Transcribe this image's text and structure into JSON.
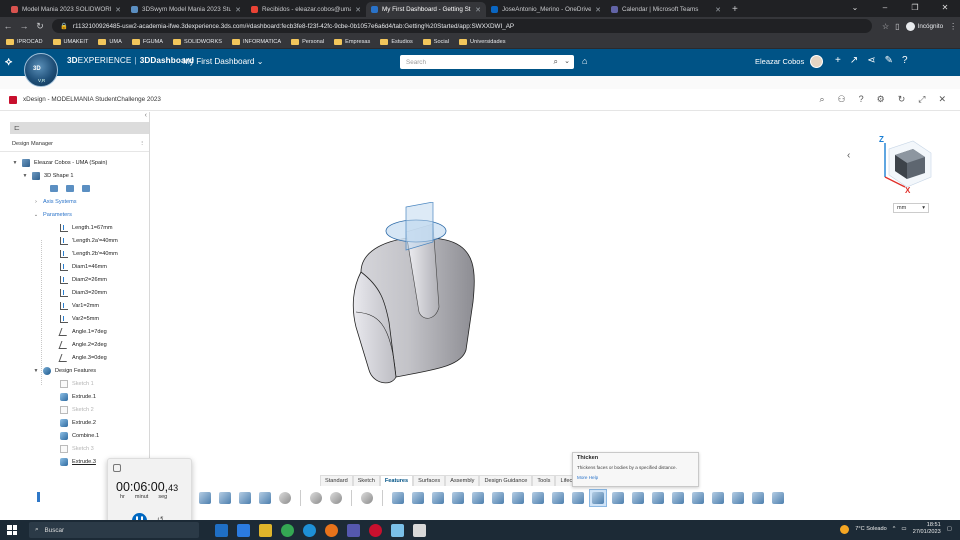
{
  "browser": {
    "tabs": [
      {
        "title": "Model Mania 2023 SOLIDWORKS",
        "color": "#d9534f",
        "active": false
      },
      {
        "title": "3DSwym Model Mania 2023 Stu",
        "color": "#5b8fc2",
        "active": false
      },
      {
        "title": "Recibidos - eleazar.cobos@uma",
        "color": "#ea4335",
        "active": false
      },
      {
        "title": "My First Dashboard - Getting St",
        "color": "#2a73c9",
        "active": true
      },
      {
        "title": "JoseAntonio_Merino - OneDrive",
        "color": "#0a66c2",
        "active": false
      },
      {
        "title": "Calendar | Microsoft Teams",
        "color": "#6264a7",
        "active": false
      }
    ],
    "url": "r1132100926485-usw2-academia-ifwe.3dexperience.3ds.com/#dashboard:fecb3fe8-f23f-42fc-9cbe-0b1057e6a6d4/tab:Getting%20Started/app:SWXXDWI_AP",
    "incognito_label": "Incógnito",
    "bookmarks": [
      "IPROCAD",
      "UMAKEIT",
      "UMA",
      "FGUMA",
      "SOLIDWORKS",
      "INFORMATICA",
      "Personal",
      "Empresas",
      "Estudios",
      "Social",
      "Universidades"
    ]
  },
  "header": {
    "brand_bold": "3D",
    "brand_rest": "EXPERIENCE",
    "product": "3DDashboard",
    "dashboard_name": "My First Dashboard",
    "compass_label": "3D",
    "compass_sub": "V,R",
    "search_placeholder": "Search",
    "user_name": "Eleazar Cobos"
  },
  "app": {
    "title": "xDesign - MODELMANIA StudentChallenge 2023"
  },
  "panel": {
    "header": "Design Manager",
    "tree": {
      "root": "Eleazar Cobos - UMA (Spain)",
      "shape": "3D Shape 1",
      "axis_systems": "Axis Systems",
      "parameters_label": "Parameters",
      "parameters": [
        {
          "label": "Length.1=67mm",
          "icon": "param"
        },
        {
          "label": "'Length.2a'=40mm",
          "icon": "param"
        },
        {
          "label": "'Length.2b'=40mm",
          "icon": "param"
        },
        {
          "label": "Diam1=46mm",
          "icon": "param"
        },
        {
          "label": "Diam2=26mm",
          "icon": "param"
        },
        {
          "label": "Diam3=20mm",
          "icon": "param"
        },
        {
          "label": "Var1=2mm",
          "icon": "param"
        },
        {
          "label": "Var2=5mm",
          "icon": "param"
        },
        {
          "label": "Angle.1=7deg",
          "icon": "angle"
        },
        {
          "label": "Angle.2=2deg",
          "icon": "angle"
        },
        {
          "label": "Angle.3=0deg",
          "icon": "angle"
        }
      ],
      "features_label": "Design Features",
      "features": [
        {
          "label": "Sketch 1",
          "state": "grey",
          "icon": "sketch"
        },
        {
          "label": "Extrude.1",
          "state": "normal",
          "icon": "extrude"
        },
        {
          "label": "Sketch 2",
          "state": "grey",
          "icon": "sketch"
        },
        {
          "label": "Extrude.2",
          "state": "normal",
          "icon": "extrude"
        },
        {
          "label": "Combine.1",
          "state": "normal",
          "icon": "extrude"
        },
        {
          "label": "Sketch 3",
          "state": "grey",
          "icon": "sketch"
        },
        {
          "label": "Extrude.3",
          "state": "selected",
          "icon": "extrude"
        }
      ]
    }
  },
  "viewport": {
    "axis_z": "Z",
    "axis_x": "X",
    "units": "mm"
  },
  "toolbar": {
    "tabs": [
      "Standard",
      "Sketch",
      "Features",
      "Surfaces",
      "Assembly",
      "Design Guidance",
      "Tools",
      "Lifec"
    ],
    "active_tab": "Features"
  },
  "tooltip": {
    "title": "Thicken",
    "description": "Thickens faces or bodies by a specified distance.",
    "link": "More Help"
  },
  "timer": {
    "time": "00:06:00,",
    "centiseconds": "43",
    "unit_hr": "hr",
    "unit_min": "minut",
    "unit_sec": "seg"
  },
  "taskbar": {
    "search": "Buscar",
    "weather": "7°C  Soleado",
    "time": "18:51",
    "date": "27/01/2023"
  },
  "colors": {
    "header_bg": "#005386",
    "accent_blue": "#2a73c9",
    "taskbar_bg": "#1c2a36"
  }
}
